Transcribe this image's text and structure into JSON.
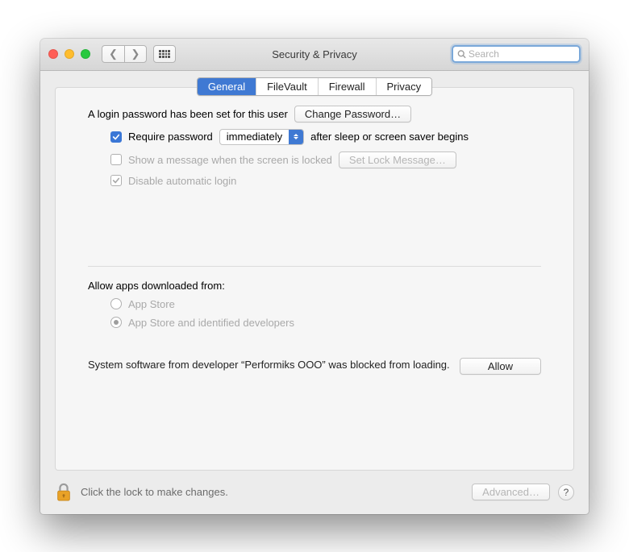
{
  "window": {
    "title": "Security & Privacy"
  },
  "search": {
    "placeholder": "Search"
  },
  "tabs": [
    {
      "label": "General",
      "active": true
    },
    {
      "label": "FileVault"
    },
    {
      "label": "Firewall"
    },
    {
      "label": "Privacy"
    }
  ],
  "login": {
    "password_set_text": "A login password has been set for this user",
    "change_password_btn": "Change Password…",
    "require_pw_label": "Require password",
    "delay_value": "immediately",
    "after_sleep_text": "after sleep or screen saver begins",
    "show_message_label": "Show a message when the screen is locked",
    "set_lock_msg_btn": "Set Lock Message…",
    "disable_auto_login_label": "Disable automatic login"
  },
  "gatekeeper": {
    "heading": "Allow apps downloaded from:",
    "option1": "App Store",
    "option2": "App Store and identified developers",
    "blocked_msg": "System software from developer “Performiks OOO” was blocked from loading.",
    "allow_btn": "Allow"
  },
  "footer": {
    "lock_text": "Click the lock to make changes.",
    "advanced_btn": "Advanced…"
  }
}
